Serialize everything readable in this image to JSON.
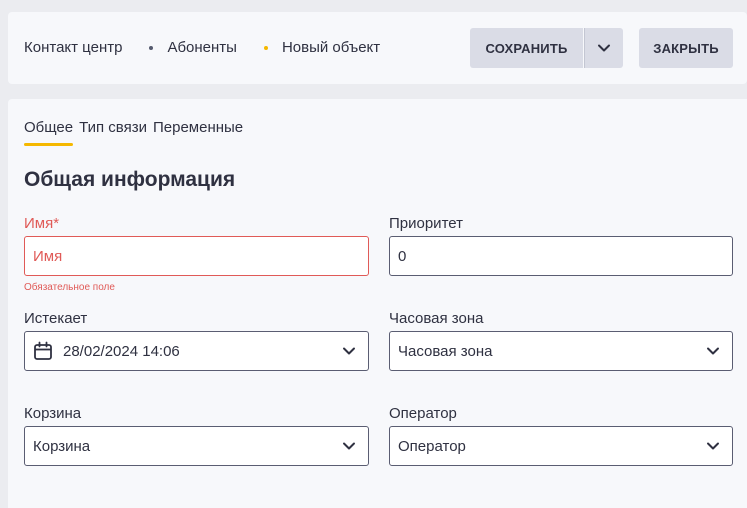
{
  "breadcrumb": [
    "Контакт центр",
    "Абоненты",
    "Новый объект"
  ],
  "toolbar": {
    "save_label": "СОХРАНИТЬ",
    "close_label": "ЗАКРЫТЬ"
  },
  "tabs": [
    {
      "label": "Общее",
      "active": true
    },
    {
      "label": "Тип связи",
      "active": false
    },
    {
      "label": "Переменные",
      "active": false
    }
  ],
  "section_title": "Общая информация",
  "form": {
    "name": {
      "label": "Имя*",
      "placeholder": "Имя",
      "value": "",
      "error": "Обязательное поле"
    },
    "priority": {
      "label": "Приоритет",
      "value": "0"
    },
    "expires": {
      "label": "Истекает",
      "value": "28/02/2024 14:06"
    },
    "timezone": {
      "label": "Часовая зона",
      "value": "Часовая зона"
    },
    "basket": {
      "label": "Корзина",
      "value": "Корзина"
    },
    "operator": {
      "label": "Оператор",
      "value": "Оператор"
    }
  },
  "colors": {
    "accent": "#f5b800",
    "error": "#e05a57",
    "button_bg": "#dadce6"
  }
}
